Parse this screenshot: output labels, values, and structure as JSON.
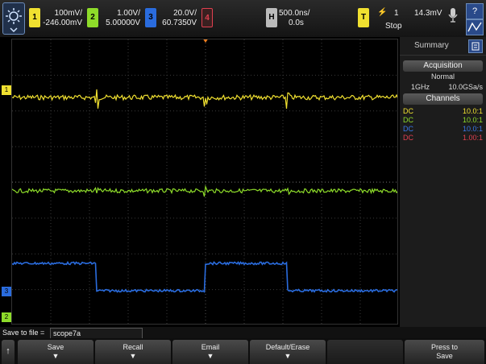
{
  "topbar": {
    "ch1": {
      "num": "1",
      "scale": "100mV/",
      "offset": "-246.00mV",
      "color": "#f0e030"
    },
    "ch2": {
      "num": "2",
      "scale": "1.00V/",
      "offset": "5.00000V",
      "color": "#8edc2a"
    },
    "ch3": {
      "num": "3",
      "scale": "20.0V/",
      "offset": "60.7350V",
      "color": "#2a6cde"
    },
    "ch4": {
      "num": "4",
      "color": "#e04050"
    },
    "horiz": {
      "tag": "H",
      "timebase": "500.0ns/",
      "delay": "0.0s"
    },
    "trigger": {
      "tag": "T",
      "source": "1",
      "level": "14.3mV",
      "status": "Stop"
    }
  },
  "sidebar": {
    "tab": "Summary",
    "acq_label": "Acquisition",
    "acq_mode": "Normal",
    "bandwidth": "1GHz",
    "sample_rate": "10.0GSa/s",
    "channels_label": "Channels",
    "channels": [
      {
        "coupling": "DC",
        "probe": "10.0:1",
        "color": "#f0e030"
      },
      {
        "coupling": "DC",
        "probe": "10.0:1",
        "color": "#8edc2a"
      },
      {
        "coupling": "DC",
        "probe": "10.0:1",
        "color": "#3a78e8"
      },
      {
        "coupling": "DC",
        "probe": "1.00:1",
        "color": "#e04050"
      }
    ]
  },
  "savebar": {
    "label": "Save to file =",
    "filename": "scope7a"
  },
  "softkeys": {
    "back": "↑",
    "save": "Save",
    "recall": "Recall",
    "email": "Email",
    "default_erase": "Default/Erase",
    "press_to": "Press to",
    "press_save": "Save"
  },
  "markers": {
    "ch1": "1",
    "ch3": "3",
    "ch2": "2"
  }
}
